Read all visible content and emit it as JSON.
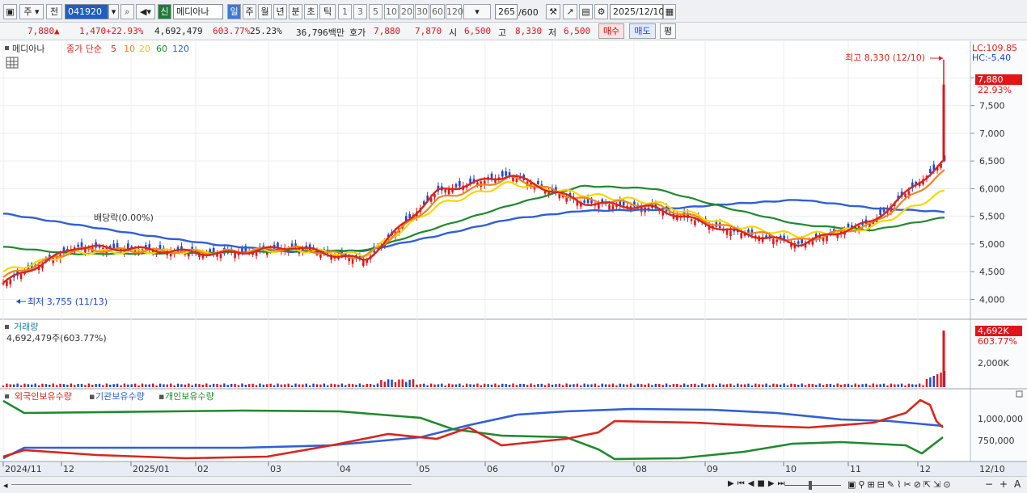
{
  "toolbar": {
    "period": "주",
    "prev": "전",
    "code": "041920",
    "badge": "신",
    "name": "메디아나",
    "tabs": [
      "일",
      "주",
      "월",
      "년",
      "분",
      "초",
      "틱"
    ],
    "nums": [
      "1",
      "3",
      "5",
      "10",
      "20",
      "30",
      "60",
      "120"
    ],
    "count": "265",
    "count_total": "/600",
    "date": "2025/12/10"
  },
  "quote": {
    "price": "7,880",
    "arrow": "▲",
    "change": "1,470",
    "pct": "+22.93%",
    "volume": "4,692,479",
    "vol_ratio": "603.77%",
    "turnover": "25.23%",
    "amount": "36,796백만",
    "hoga_label": "호가",
    "ask": "7,880",
    "bid": "7,870",
    "open_label": "시",
    "open": "6,500",
    "high_label": "고",
    "high": "8,330",
    "low_label": "저",
    "low": "6,500",
    "buy": "매수",
    "sell": "매도",
    "eval": "평"
  },
  "legend": {
    "name": "메디아나",
    "ma_label": "종가 단순",
    "ma_periods": [
      "5",
      "10",
      "20",
      "60",
      "120"
    ],
    "ma_colors": [
      "#d8261c",
      "#f58220",
      "#f4d800",
      "#1f8a2d",
      "#2f5fd8"
    ]
  },
  "side": {
    "lc": "LC:109.85",
    "hc": "HC:-5.40",
    "price_tag": "7,880",
    "pct_tag": "22.93%",
    "vol_tag": "4,692K",
    "vol_pct": "603.77%"
  },
  "annotations": {
    "high": "최고 8,330 (12/10)",
    "low": "최저 3,755 (11/13)",
    "dividend": "배당락(0.00%)"
  },
  "volume_panel": {
    "title": "거래량",
    "value": "4,692,479주(603.77%)",
    "tick": "2,000K"
  },
  "holding_panel": {
    "labels": [
      "외국인보유수량",
      "기관보유수량",
      "개인보유수량"
    ],
    "colors": [
      "#d8261c",
      "#2f5fd8",
      "#1f8a2d"
    ],
    "ticks": [
      "1,000,000",
      "750,000"
    ]
  },
  "xaxis": [
    "2024/11",
    "12",
    "2025/01",
    "02",
    "03",
    "04",
    "05",
    "06",
    "07",
    "08",
    "09",
    "10",
    "11",
    "12"
  ],
  "xaxis_right": "12/10",
  "price_ticks": [
    "8,000",
    "7,500",
    "7,000",
    "6,500",
    "6,000",
    "5,500",
    "5,000",
    "4,500",
    "4,000"
  ],
  "chart_data": {
    "type": "line",
    "title": "메디아나",
    "ylim": [
      3700,
      8400
    ],
    "series": [
      {
        "name": "5",
        "x": [
          "2024/11",
          "12",
          "2025/01",
          "02",
          "03",
          "04",
          "05",
          "06",
          "07",
          "08",
          "09",
          "10",
          "11",
          "12/10"
        ],
        "values": [
          4300,
          4950,
          4900,
          4820,
          4950,
          4700,
          5950,
          6250,
          5750,
          5650,
          5250,
          5000,
          5400,
          6500
        ]
      },
      {
        "name": "10",
        "x": [
          "2024/11",
          "12",
          "2025/01",
          "02",
          "03",
          "04",
          "05",
          "06",
          "07",
          "08",
          "09",
          "10",
          "11",
          "12/10"
        ],
        "values": [
          4400,
          4900,
          4880,
          4850,
          4930,
          4750,
          5800,
          6200,
          5800,
          5700,
          5300,
          5050,
          5350,
          6300
        ]
      },
      {
        "name": "20",
        "x": [
          "2024/11",
          "12",
          "2025/01",
          "02",
          "03",
          "04",
          "05",
          "06",
          "07",
          "08",
          "09",
          "10",
          "11",
          "12/10"
        ],
        "values": [
          4500,
          4850,
          4870,
          4860,
          4900,
          4800,
          5700,
          6100,
          5900,
          5750,
          5350,
          5150,
          5300,
          5950
        ]
      },
      {
        "name": "60",
        "x": [
          "2024/11",
          "12",
          "2025/01",
          "02",
          "03",
          "04",
          "05",
          "06",
          "07",
          "08",
          "09",
          "10",
          "11",
          "12/10"
        ],
        "values": [
          4950,
          4820,
          4830,
          4850,
          4870,
          4880,
          5300,
          5700,
          6050,
          6000,
          5650,
          5350,
          5250,
          5480
        ]
      },
      {
        "name": "120",
        "x": [
          "2024/11",
          "12",
          "2025/01",
          "02",
          "03",
          "04",
          "05",
          "06",
          "07",
          "08",
          "09",
          "10",
          "11",
          "12/10"
        ],
        "values": [
          5550,
          5350,
          5150,
          4980,
          4860,
          4880,
          5150,
          5450,
          5600,
          5620,
          5720,
          5800,
          5650,
          5580
        ]
      }
    ]
  }
}
